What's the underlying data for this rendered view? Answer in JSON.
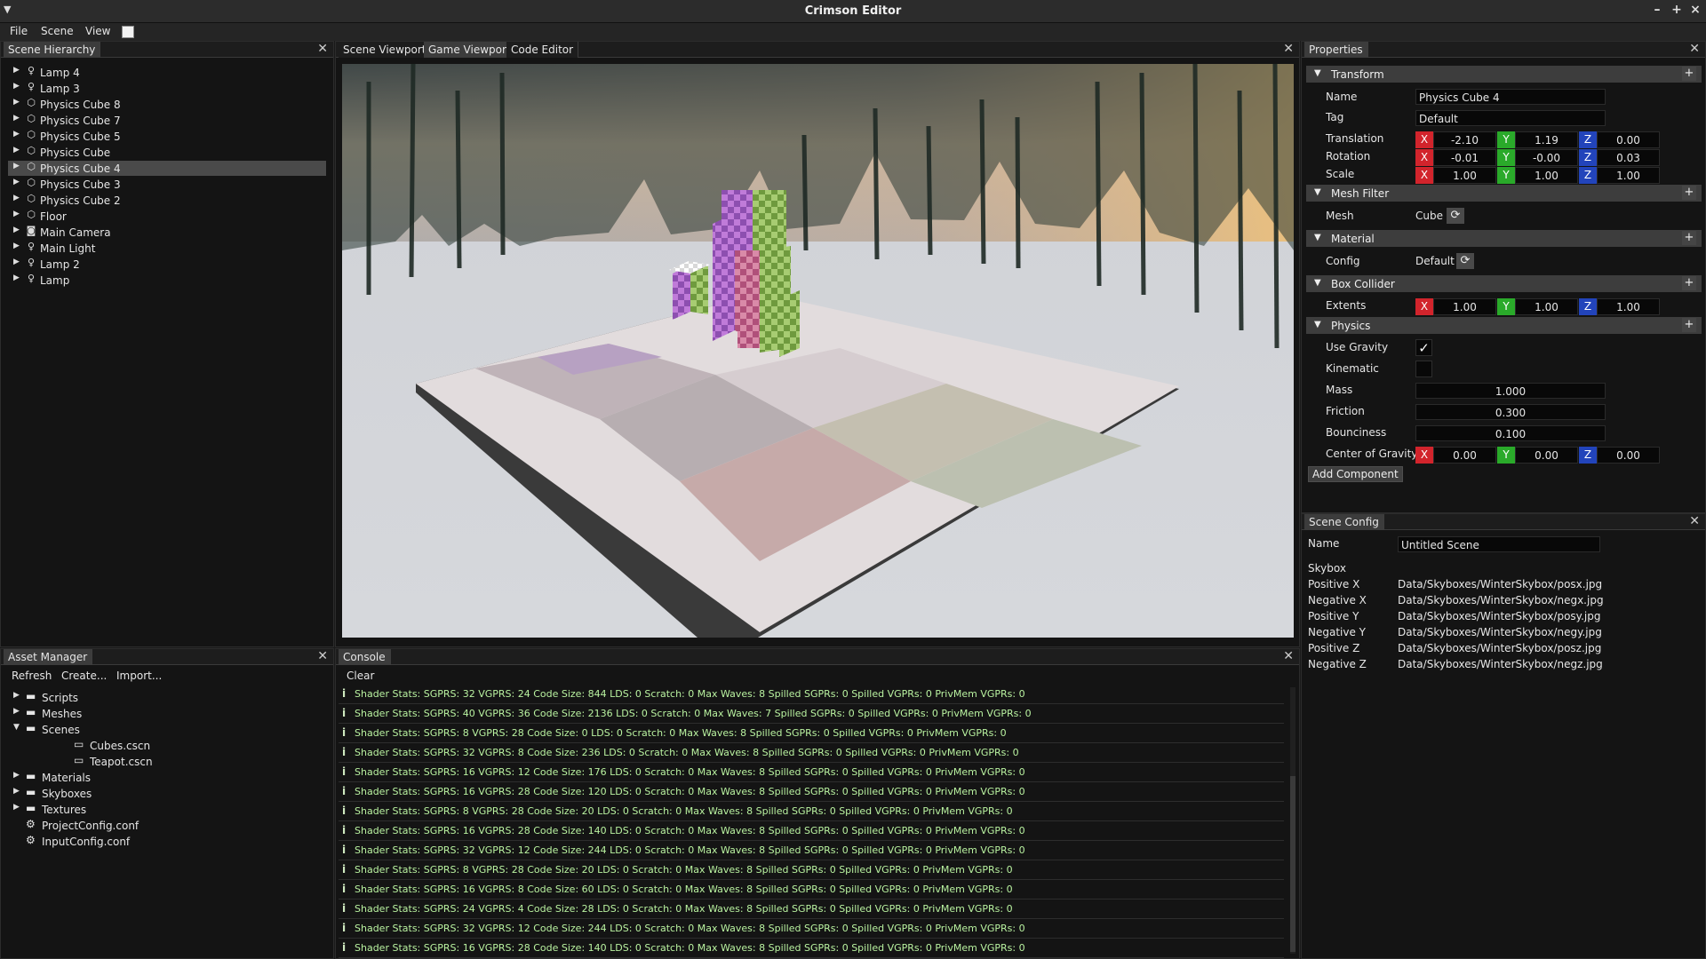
{
  "app": {
    "title": "Crimson Editor"
  },
  "menu": {
    "items": [
      "File",
      "Scene",
      "View"
    ]
  },
  "hierarchy": {
    "tab": "Scene Hierarchy",
    "items": [
      {
        "label": "Lamp 4",
        "icon": "lamp-icon",
        "selected": false
      },
      {
        "label": "Lamp 3",
        "icon": "lamp-icon",
        "selected": false
      },
      {
        "label": "Physics Cube 8",
        "icon": "cube-icon",
        "selected": false
      },
      {
        "label": "Physics Cube 7",
        "icon": "cube-icon",
        "selected": false
      },
      {
        "label": "Physics Cube 5",
        "icon": "cube-icon",
        "selected": false
      },
      {
        "label": "Physics Cube",
        "icon": "cube-icon",
        "selected": false
      },
      {
        "label": "Physics Cube 4",
        "icon": "cube-icon",
        "selected": true
      },
      {
        "label": "Physics Cube 3",
        "icon": "cube-icon",
        "selected": false
      },
      {
        "label": "Physics Cube 2",
        "icon": "cube-icon",
        "selected": false
      },
      {
        "label": "Floor",
        "icon": "cube-icon",
        "selected": false
      },
      {
        "label": "Main Camera",
        "icon": "camera-icon",
        "selected": false
      },
      {
        "label": "Main Light",
        "icon": "lamp-icon",
        "selected": false
      },
      {
        "label": "Lamp 2",
        "icon": "lamp-icon",
        "selected": false
      },
      {
        "label": "Lamp",
        "icon": "lamp-icon",
        "selected": false
      }
    ]
  },
  "viewport": {
    "tabs": [
      "Scene Viewport",
      "Game Viewport",
      "Code Editor"
    ],
    "active_tab": "Game Viewport"
  },
  "properties": {
    "tab": "Properties",
    "transform": {
      "title": "Transform",
      "name_label": "Name",
      "name": "Physics Cube 4",
      "tag_label": "Tag",
      "tag": "Default",
      "translation_label": "Translation",
      "translation": [
        "-2.10",
        "1.19",
        "0.00"
      ],
      "rotation_label": "Rotation",
      "rotation": [
        "-0.01",
        "-0.00",
        "0.03"
      ],
      "scale_label": "Scale",
      "scale": [
        "1.00",
        "1.00",
        "1.00"
      ]
    },
    "mesh_filter": {
      "title": "Mesh Filter",
      "mesh_label": "Mesh",
      "mesh": "Cube"
    },
    "material": {
      "title": "Material",
      "config_label": "Config",
      "config": "Default"
    },
    "box_collider": {
      "title": "Box Collider",
      "extents_label": "Extents",
      "extents": [
        "1.00",
        "1.00",
        "1.00"
      ]
    },
    "physics": {
      "title": "Physics",
      "use_gravity_label": "Use Gravity",
      "use_gravity": true,
      "kinematic_label": "Kinematic",
      "kinematic": false,
      "mass_label": "Mass",
      "mass": "1.000",
      "friction_label": "Friction",
      "friction": "0.300",
      "bounciness_label": "Bounciness",
      "bounciness": "0.100",
      "cog_label": "Center of Gravity",
      "cog": [
        "0.00",
        "0.00",
        "0.00"
      ]
    },
    "add_component": "Add Component"
  },
  "scene_config": {
    "tab": "Scene Config",
    "name_label": "Name",
    "name": "Untitled Scene",
    "skybox_label": "Skybox",
    "faces": [
      {
        "label": "Positive X",
        "path": "Data/Skyboxes/WinterSkybox/posx.jpg"
      },
      {
        "label": "Negative X",
        "path": "Data/Skyboxes/WinterSkybox/negx.jpg"
      },
      {
        "label": "Positive Y",
        "path": "Data/Skyboxes/WinterSkybox/posy.jpg"
      },
      {
        "label": "Negative Y",
        "path": "Data/Skyboxes/WinterSkybox/negy.jpg"
      },
      {
        "label": "Positive Z",
        "path": "Data/Skyboxes/WinterSkybox/posz.jpg"
      },
      {
        "label": "Negative Z",
        "path": "Data/Skyboxes/WinterSkybox/negz.jpg"
      }
    ]
  },
  "assets": {
    "tab": "Asset Manager",
    "toolbar": [
      "Refresh",
      "Create...",
      "Import..."
    ],
    "items": [
      {
        "label": "Scripts",
        "type": "folder",
        "depth": 0,
        "arrow": "right"
      },
      {
        "label": "Meshes",
        "type": "folder",
        "depth": 0,
        "arrow": "right"
      },
      {
        "label": "Scenes",
        "type": "folder",
        "depth": 0,
        "arrow": "down"
      },
      {
        "label": "Cubes.cscn",
        "type": "file",
        "depth": 1,
        "arrow": "none"
      },
      {
        "label": "Teapot.cscn",
        "type": "file",
        "depth": 1,
        "arrow": "none"
      },
      {
        "label": "Materials",
        "type": "folder",
        "depth": 0,
        "arrow": "right"
      },
      {
        "label": "Skyboxes",
        "type": "folder",
        "depth": 0,
        "arrow": "right"
      },
      {
        "label": "Textures",
        "type": "folder",
        "depth": 0,
        "arrow": "right"
      },
      {
        "label": "ProjectConfig.conf",
        "type": "config",
        "depth": 0,
        "arrow": "none"
      },
      {
        "label": "InputConfig.conf",
        "type": "config",
        "depth": 0,
        "arrow": "none"
      }
    ]
  },
  "console": {
    "tab": "Console",
    "clear": "Clear",
    "lines": [
      "Shader Stats: SGPRS: 32 VGPRS: 24 Code Size: 844 LDS: 0 Scratch: 0 Max Waves: 8 Spilled SGPRs: 0 Spilled VGPRs: 0 PrivMem VGPRs: 0",
      "Shader Stats: SGPRS: 40 VGPRS: 36 Code Size: 2136 LDS: 0 Scratch: 0 Max Waves: 7 Spilled SGPRs: 0 Spilled VGPRs: 0 PrivMem VGPRs: 0",
      "Shader Stats: SGPRS: 8 VGPRS: 28 Code Size: 0 LDS: 0 Scratch: 0 Max Waves: 8 Spilled SGPRs: 0 Spilled VGPRs: 0 PrivMem VGPRs: 0",
      "Shader Stats: SGPRS: 32 VGPRS: 8 Code Size: 236 LDS: 0 Scratch: 0 Max Waves: 8 Spilled SGPRs: 0 Spilled VGPRs: 0 PrivMem VGPRs: 0",
      "Shader Stats: SGPRS: 16 VGPRS: 12 Code Size: 176 LDS: 0 Scratch: 0 Max Waves: 8 Spilled SGPRs: 0 Spilled VGPRs: 0 PrivMem VGPRs: 0",
      "Shader Stats: SGPRS: 16 VGPRS: 28 Code Size: 120 LDS: 0 Scratch: 0 Max Waves: 8 Spilled SGPRs: 0 Spilled VGPRs: 0 PrivMem VGPRs: 0",
      "Shader Stats: SGPRS: 8 VGPRS: 28 Code Size: 20 LDS: 0 Scratch: 0 Max Waves: 8 Spilled SGPRs: 0 Spilled VGPRs: 0 PrivMem VGPRs: 0",
      "Shader Stats: SGPRS: 16 VGPRS: 28 Code Size: 140 LDS: 0 Scratch: 0 Max Waves: 8 Spilled SGPRs: 0 Spilled VGPRs: 0 PrivMem VGPRs: 0",
      "Shader Stats: SGPRS: 32 VGPRS: 12 Code Size: 244 LDS: 0 Scratch: 0 Max Waves: 8 Spilled SGPRs: 0 Spilled VGPRs: 0 PrivMem VGPRs: 0",
      "Shader Stats: SGPRS: 8 VGPRS: 28 Code Size: 20 LDS: 0 Scratch: 0 Max Waves: 8 Spilled SGPRs: 0 Spilled VGPRs: 0 PrivMem VGPRs: 0",
      "Shader Stats: SGPRS: 16 VGPRS: 8 Code Size: 60 LDS: 0 Scratch: 0 Max Waves: 8 Spilled SGPRs: 0 Spilled VGPRs: 0 PrivMem VGPRs: 0",
      "Shader Stats: SGPRS: 24 VGPRS: 4 Code Size: 28 LDS: 0 Scratch: 0 Max Waves: 8 Spilled SGPRs: 0 Spilled VGPRs: 0 PrivMem VGPRs: 0",
      "Shader Stats: SGPRS: 32 VGPRS: 12 Code Size: 244 LDS: 0 Scratch: 0 Max Waves: 8 Spilled SGPRs: 0 Spilled VGPRs: 0 PrivMem VGPRs: 0",
      "Shader Stats: SGPRS: 16 VGPRS: 28 Code Size: 140 LDS: 0 Scratch: 0 Max Waves: 8 Spilled SGPRs: 0 Spilled VGPRs: 0 PrivMem VGPRs: 0"
    ]
  },
  "colors": {
    "axis_x": "#d2242c",
    "axis_y": "#2aaa2a",
    "axis_z": "#2244bb",
    "console_text": "#b9f2a0"
  }
}
